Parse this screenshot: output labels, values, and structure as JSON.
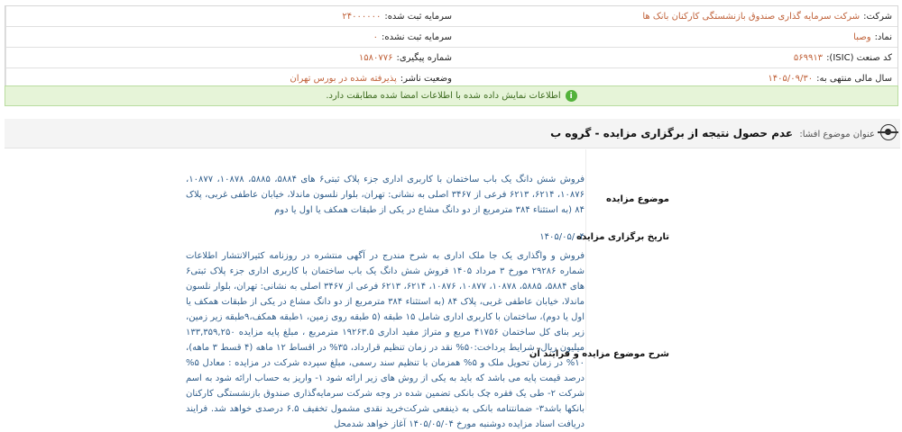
{
  "company_info": {
    "company_label": "شرکت:",
    "company_value": "شرکت سرمایه گذاری صندوق بازنشستگی کارکنان بانک ها",
    "registered_capital_label": "سرمایه ثبت شده:",
    "registered_capital_value": "۲۴۰۰۰۰۰۰",
    "symbol_label": "نماد:",
    "symbol_value": "وصبا",
    "unregistered_capital_label": "سرمایه ثبت نشده:",
    "unregistered_capital_value": "۰",
    "isic_label": "کد صنعت (ISIC):",
    "isic_value": "۵۶۹۹۱۳",
    "tracking_label": "شماره پیگیری:",
    "tracking_value": "۱۵۸۰۷۷۶",
    "fiscal_year_label": "سال مالی منتهی به:",
    "fiscal_year_value": "۱۴۰۵/۰۹/۳۰",
    "publisher_status_label": "وضعیت ناشر:",
    "publisher_status_value": "پذیرفته شده در بورس تهران"
  },
  "alert": {
    "icon": "info-icon",
    "text": "اطلاعات نمایش داده شده با اطلاعات امضا شده مطابقت دارد."
  },
  "disclosure": {
    "subject_label": "عنوان موضوع افشا:",
    "subject_value": "عدم حصول نتیجه از برگزاری مزایده - گروه ب"
  },
  "auction": {
    "subject_label": "موضوع مزایده",
    "subject_value": "فروش شش دانگ یک باب ساختمان با کاربری اداری جزء پلاک ثبتی۶ های ۵۸۸۴، ۵۸۸۵، ۱۰۸۷۸، ۱۰۸۷۷، ۱۰۸۷۶، ۶۲۱۴، ۶۲۱۳ فرعی از ۳۴۶۷ اصلی به نشانی: تهران، بلوار نلسون ماندلا، خیابان عاطفی غربی، پلاک ۸۴ (به استثناء ۳۸۴ مترمربع از دو دانگ مشاع در یکی از طبقات همکف یا اول یا دوم",
    "date_label": "تاریخ برگزاری مزایده",
    "date_value": "۱۴۰۵/۰۵/۰۴",
    "desc_label": "شرح موضوع مزایده و فرایند آن",
    "desc_value": "فروش و واگذاری یک جا ملک اداری به شرح مندرج در آگهی منتشره در روزنامه کثیرالانتشار اطلاعات شماره ۲۹۲۸۶ مورخ ۳ مرداد ۱۴۰۵ فروش شش دانگ یک باب ساختمان با کاربری اداری جزء پلاک ثبتی۶ های ۵۸۸۴، ۵۸۸۵، ۱۰۸۷۸، ۱۰۸۷۷، ۱۰۸۷۶، ۶۲۱۴، ۶۲۱۳ فرعی از ۳۴۶۷ اصلی به نشانی: تهران، بلوار نلسون ماندلا، خیابان عاطفی غربی، پلاک ۸۴ (به استثناء ۳۸۴ مترمربع از دو دانگ مشاع در یکی از طبقات همکف یا اول یا دوم)، ساختمان با کاربری اداری شامل ۱۵ طبقه (۵ طبقه روی زمین، ۱طبقه همکف،۹طبقه زیر زمین، زیر بنای کل ساختمان ۴۱۷۵۶ مربع و متراژ مفید اداری ۱۹۲۶۳.۵ مترمربع ، مبلغ پایه مزایده ۱۳۳,۳۵۹,۲۵۰ میلیون ریال، شرایط پرداخت:۵۰% نقد در زمان تنظیم قرارداد، ۳۵% در اقساط ۱۲ ماهه (۴ قسط ۳ ماهه)، ۱۰% در زمان تحویل ملک و ۵% همزمان با تنظیم سند رسمی، مبلغ سپرده شرکت در مزایده : معادل ۵% درصد قیمت پایه می باشد که باید به یکی از روش های زیر ارائه شود ۱- واریز به حساب ارائه شود به اسم شرکت ۲- طی یک فقره چک بانکی تضمین شده در وجه شرکت سرمایه‌گذاری صندوق بازنشستگی کارکنان بانکها باشد۳- ضمانتنامه بانکی به ذینفعی شرکت‌خرید نقدی مشمول تخفیف ۶.۵ درصدی خواهد شد. فرایند دریافت اسناد مزایده دوشنبه مورخ ۱۴۰۵/۰۵/۰۴ آغاز خواهد شد‌محل"
  }
}
